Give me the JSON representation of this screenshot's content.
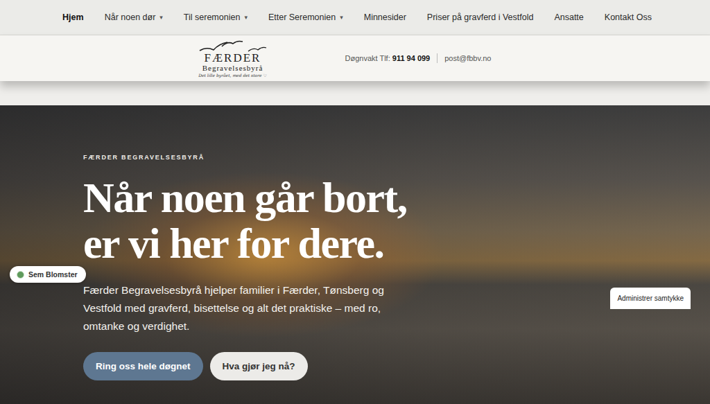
{
  "nav": {
    "caret": "▾",
    "items": [
      {
        "label": "Hjem",
        "selected": true,
        "dropdown": false
      },
      {
        "label": "Når noen dør",
        "selected": false,
        "dropdown": true
      },
      {
        "label": "Til seremonien",
        "selected": false,
        "dropdown": true
      },
      {
        "label": "Etter Seremonien",
        "selected": false,
        "dropdown": true
      },
      {
        "label": "Minnesider",
        "selected": false,
        "dropdown": false
      },
      {
        "label": "Priser på gravferd i Vestfold",
        "selected": false,
        "dropdown": false
      },
      {
        "label": "Ansatte",
        "selected": false,
        "dropdown": false
      },
      {
        "label": "Kontakt Oss",
        "selected": false,
        "dropdown": false
      }
    ]
  },
  "header": {
    "logo": {
      "name": "FÆRDER",
      "subtitle": "Begravelsesbyrå",
      "tagline": "Det lille byrået, med det store ♡"
    },
    "phone_label": "Døgnvakt Tlf:",
    "phone": "911 94 099",
    "email": "post@fbbv.no"
  },
  "hero": {
    "eyebrow": "FÆRDER BEGRAVELSESBYRÅ",
    "heading": [
      "Når noen går bort,",
      "er vi her for dere."
    ],
    "text": "Færder Begravelsesbyrå hjelper familier i Færder, Tønsberg og Vestfold med gravferd, bisettelse og alt det praktiske – med ro, omtanke og verdighet.",
    "buttons": [
      {
        "label": "Ring oss hele døgnet",
        "kind": "primary"
      },
      {
        "label": "Hva gjør jeg nå?",
        "kind": "secondary"
      }
    ]
  },
  "badge": {
    "label": "Sem Blomster"
  },
  "consent": {
    "label": "Administrer samtykke"
  }
}
